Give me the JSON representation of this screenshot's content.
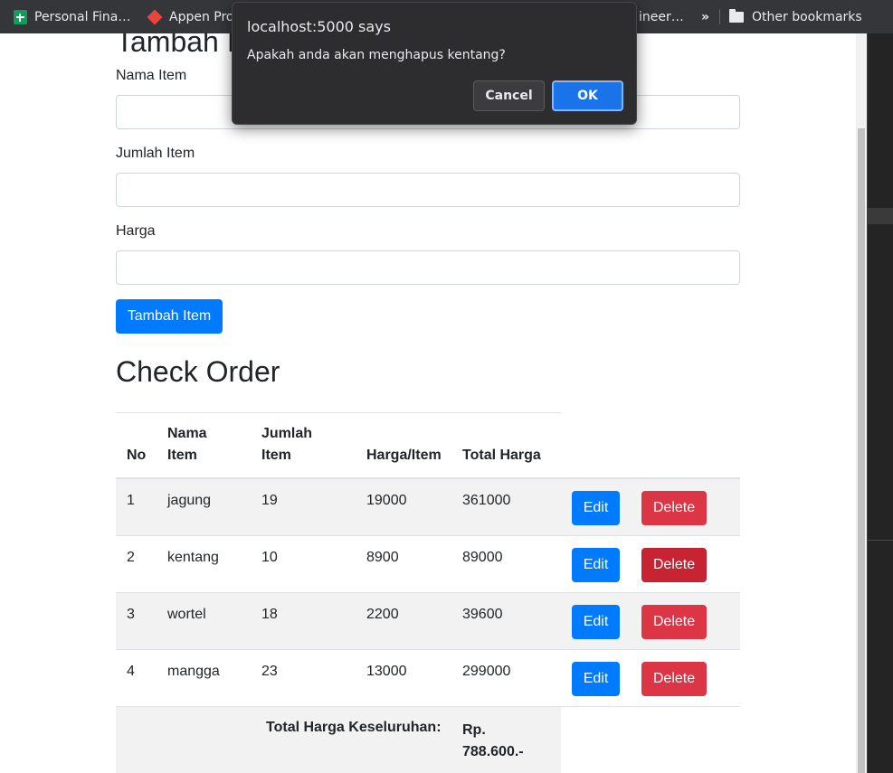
{
  "bookmarks": {
    "items": [
      {
        "label": "Personal Fina…",
        "icon": "sheets-icon"
      },
      {
        "label": "Appen Pro",
        "icon": "appen-icon"
      },
      {
        "label": "ineer…"
      }
    ],
    "overflow": "»",
    "other": "Other bookmarks"
  },
  "form": {
    "title_partial": "Tambah I",
    "nama_label": "Nama Item",
    "jumlah_label": "Jumlah Item",
    "harga_label": "Harga",
    "nama_value": "",
    "jumlah_value": "",
    "harga_value": "",
    "submit_label": "Tambah Item"
  },
  "order": {
    "title": "Check Order",
    "headers": {
      "no": "No",
      "nama_1": "Nama",
      "nama_2": "Item",
      "jumlah_1": "Jumlah",
      "jumlah_2": "Item",
      "harga": "Harga/Item",
      "total": "Total Harga"
    },
    "rows": [
      {
        "no": "1",
        "nama": "jagung",
        "jumlah": "19",
        "harga": "19000",
        "total": "361000"
      },
      {
        "no": "2",
        "nama": "kentang",
        "jumlah": "10",
        "harga": "8900",
        "total": "89000"
      },
      {
        "no": "3",
        "nama": "wortel",
        "jumlah": "18",
        "harga": "2200",
        "total": "39600"
      },
      {
        "no": "4",
        "nama": "mangga",
        "jumlah": "23",
        "harga": "13000",
        "total": "299000"
      }
    ],
    "edit_label": "Edit",
    "delete_label": "Delete",
    "total_label": "Total Harga Keseluruhan:",
    "total_value_1": "Rp.",
    "total_value_2": "788.600.-"
  },
  "dialog": {
    "title": "localhost:5000 says",
    "message": "Apakah anda akan menghapus kentang?",
    "cancel": "Cancel",
    "ok": "OK"
  },
  "colors": {
    "primary": "#007bff",
    "danger": "#dc3545",
    "dialog_bg": "#2d2d2f",
    "bookmarks_bg": "#35363a"
  }
}
